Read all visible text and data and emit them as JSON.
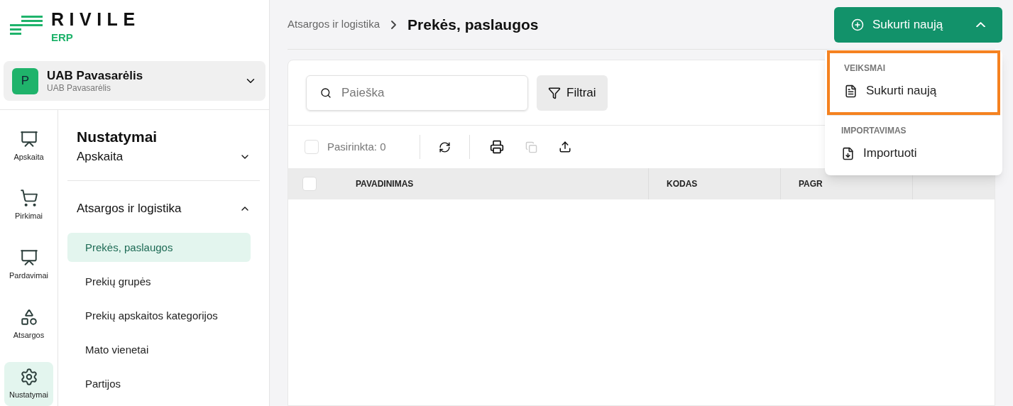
{
  "logo": {
    "name": "RIVILE",
    "sub": "ERP"
  },
  "company": {
    "initial": "P",
    "name": "UAB Pavasarėlis",
    "sub": "UAB Pavasarėlis"
  },
  "rail": [
    {
      "label": "Apskaita",
      "kind": "chart",
      "selected": false
    },
    {
      "label": "Pirkimai",
      "kind": "cart",
      "selected": false
    },
    {
      "label": "Pardavimai",
      "kind": "sales",
      "selected": false
    },
    {
      "label": "Atsargos",
      "kind": "shapes",
      "selected": false
    },
    {
      "label": "Nustatymai",
      "kind": "gear",
      "selected": true
    }
  ],
  "nav": {
    "title": "Nustatymai",
    "sections": [
      {
        "label": "Apskaita",
        "expanded": false
      },
      {
        "label": "Atsargos ir logistika",
        "expanded": true,
        "children": [
          {
            "label": "Prekės, paslaugos",
            "selected": true
          },
          {
            "label": "Prekių grupės",
            "selected": false
          },
          {
            "label": "Prekių apskaitos kategorijos",
            "selected": false
          },
          {
            "label": "Mato vienetai",
            "selected": false
          },
          {
            "label": "Partijos",
            "selected": false
          }
        ]
      }
    ]
  },
  "breadcrumb": {
    "parent": "Atsargos ir logistika",
    "current": "Prekės, paslaugos"
  },
  "create_button": {
    "label": "Sukurti naują",
    "expanded": true
  },
  "search": {
    "placeholder": "Paieška"
  },
  "filter_button": "Filtrai",
  "toolbar": {
    "selected_count": "Pasirinkta: 0",
    "checked": false
  },
  "table": {
    "columns": [
      "PAVADINIMAS",
      "KODAS",
      "PAGR"
    ],
    "all_checked": false
  },
  "menu": [
    {
      "title": "VEIKSMAI",
      "highlighted": true,
      "items": [
        {
          "label": "Sukurti naują",
          "kind": "document"
        }
      ]
    },
    {
      "title": "IMPORTAVIMAS",
      "highlighted": false,
      "items": [
        {
          "label": "Importuoti",
          "kind": "import"
        }
      ]
    }
  ]
}
